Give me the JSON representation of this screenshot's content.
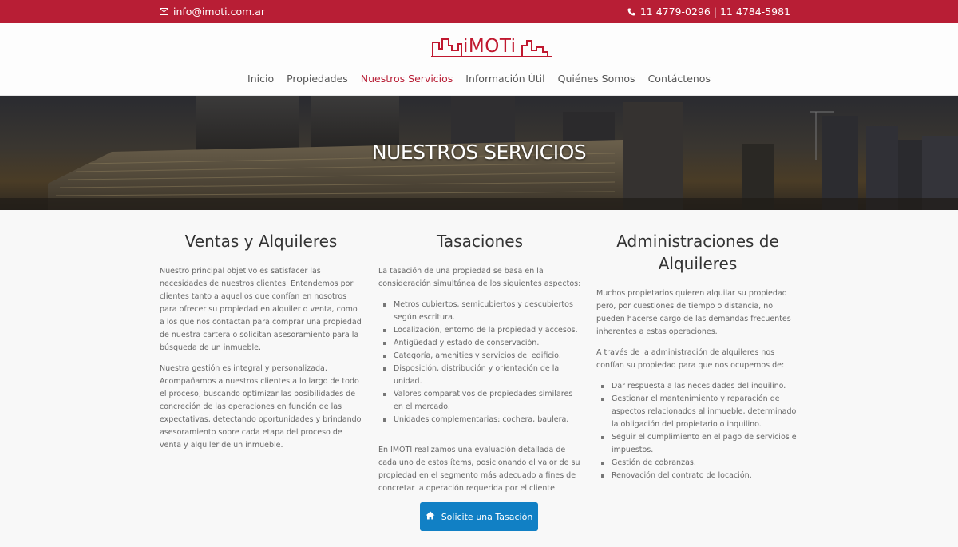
{
  "topbar": {
    "email": "info@imoti.com.ar",
    "phone": "11 4779-0296 | 11 4784-5981",
    "background": "#b81e35"
  },
  "logo": {
    "text": "iMOTi"
  },
  "nav": {
    "items": [
      {
        "label": "Inicio"
      },
      {
        "label": "Propiedades"
      },
      {
        "label": "Nuestros Servicios",
        "active": true
      },
      {
        "label": "Información Útil"
      },
      {
        "label": "Quiénes Somos"
      },
      {
        "label": "Contáctenos"
      }
    ]
  },
  "hero": {
    "title": "NUESTROS SERVICIOS"
  },
  "ventas": {
    "title": "Ventas y Alquileres",
    "p1": "Nuestro principal objetivo es satisfacer las necesidades de nuestros clientes. Entendemos por clientes tanto a aquellos que confían en nosotros para ofrecer su propiedad en alquiler o venta, como a los que nos contactan para comprar una propiedad de nuestra cartera o solicitan asesoramiento para la búsqueda de un inmueble.",
    "p2": "Nuestra gestión es integral y personalizada. Acompañamos a nuestros clientes a lo largo de todo el proceso, buscando optimizar las posibilidades de concreción de las operaciones en función de las expectativas, detectando oportunidades y brindando asesoramiento sobre cada etapa del proceso de venta y alquiler de un inmueble."
  },
  "tasaciones": {
    "title": "Tasaciones",
    "intro": "La tasación de una propiedad se basa en la consideración simultánea de los siguientes aspectos:",
    "items": [
      "Metros cubiertos, semicubiertos y descubiertos según escritura.",
      "Localización, entorno de la propiedad y accesos.",
      "Antigüedad y estado de conservación.",
      "Categoría, amenities y servicios del edificio.",
      "Disposición, distribución y orientación de la unidad.",
      "Valores comparativos de propiedades similares en el mercado.",
      "Unidades complementarias: cochera, baulera."
    ],
    "outro": "En IMOTI realizamos una evaluación detallada de cada uno de estos ítems, posicionando el valor de su propiedad en el segmento más adecuado a fines de concretar la operación requerida por el cliente."
  },
  "administraciones": {
    "title": "Administraciones de Alquileres",
    "p1": "Muchos propietarios quieren alquilar su propiedad pero, por cuestiones de tiempo o distancia, no pueden hacerse cargo de las demandas frecuentes inherentes a estas operaciones.",
    "p2": "A través de la administración de alquileres nos confían su propiedad para que nos ocupemos de:",
    "items": [
      "Dar respuesta a las necesidades del inquilino.",
      "Gestionar el mantenimiento y reparación de aspectos relacionados al inmueble, determinado la obligación del propietario o inquilino.",
      "Seguir el cumplimiento en el pago de servicios e impuestos.",
      "Gestión de cobranzas.",
      "Renovación del contrato de locación."
    ]
  },
  "cta": {
    "label": "Solicite una Tasación",
    "icon": "home-icon",
    "color": "#1180c5"
  }
}
